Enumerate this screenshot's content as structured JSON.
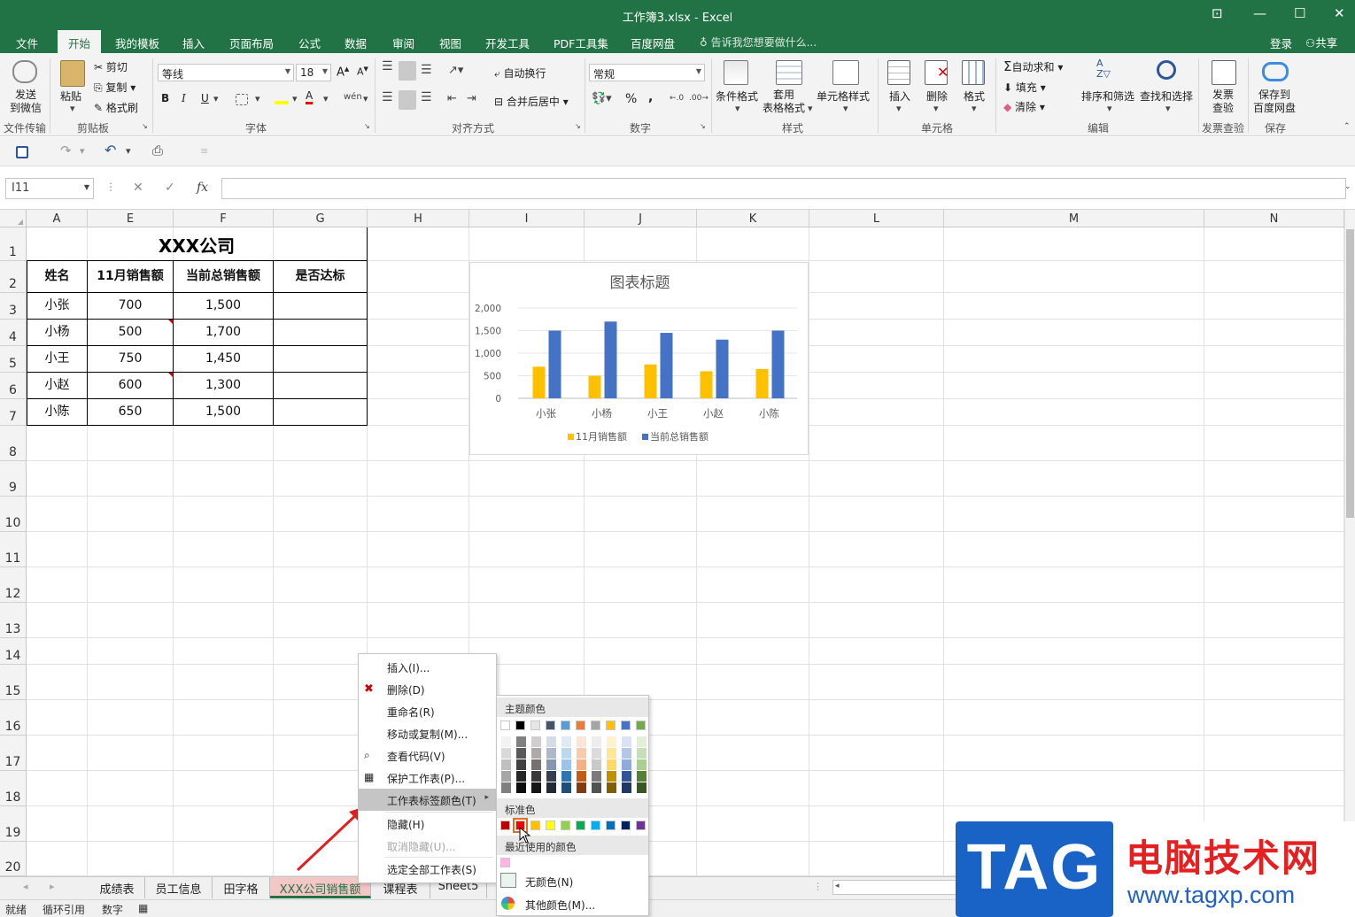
{
  "window": {
    "title": "工作簿3.xlsx - Excel",
    "controls": [
      "⊡",
      "—",
      "☐",
      "✕"
    ]
  },
  "menu": {
    "tabs": [
      "文件",
      "开始",
      "我的模板",
      "插入",
      "页面布局",
      "公式",
      "数据",
      "审阅",
      "视图",
      "开发工具",
      "PDF工具集",
      "百度网盘"
    ],
    "active": "开始",
    "tell_me": "告诉我您想要做什么...",
    "login": "登录",
    "share": "共享"
  },
  "ribbon": {
    "send_wechat": [
      "发送",
      "到微信"
    ],
    "group_file": "文件传输",
    "paste": "粘贴",
    "cut": "剪切",
    "copy": "复制",
    "format_painter": "格式刷",
    "group_clipboard": "剪贴板",
    "font_name": "等线",
    "font_size": "18",
    "bold": "B",
    "italic": "I",
    "underline": "U",
    "group_font": "字体",
    "wrap_text": "自动换行",
    "merge_center": "合并后居中",
    "group_align": "对齐方式",
    "number_format": "常规",
    "group_number": "数字",
    "percent": "%",
    "comma": ",",
    "cond_format": "条件格式",
    "table_format": [
      "套用",
      "表格格式"
    ],
    "cell_style": "单元格样式",
    "group_style": "样式",
    "insert": "插入",
    "delete": "删除",
    "format": "格式",
    "group_cells": "单元格",
    "autosum": "自动求和",
    "fill": "填充",
    "clear": "清除",
    "sort_filter": "排序和筛选",
    "find_select": "查找和选择",
    "group_edit": "编辑",
    "invoice_check": [
      "发票",
      "查验"
    ],
    "group_invoice": "发票查验",
    "save_baidu": [
      "保存到",
      "百度网盘"
    ],
    "group_save": "保存"
  },
  "formula_bar": {
    "name_box": "I11",
    "fx": "fx",
    "formula": ""
  },
  "columns": [
    {
      "label": "A"
    },
    {
      "label": "E"
    },
    {
      "label": "F"
    },
    {
      "label": "G"
    },
    {
      "label": "H"
    },
    {
      "label": "I"
    },
    {
      "label": "J"
    },
    {
      "label": "K"
    },
    {
      "label": "L"
    },
    {
      "label": "M"
    },
    {
      "label": "N"
    }
  ],
  "rows": [
    "1",
    "2",
    "3",
    "4",
    "5",
    "6",
    "7",
    "8",
    "9",
    "10",
    "11",
    "12",
    "13",
    "14",
    "15",
    "16",
    "17",
    "18",
    "19",
    "20"
  ],
  "table": {
    "title": "XXX公司",
    "headers": [
      "姓名",
      "11月销售额",
      "当前总销售额",
      "是否达标"
    ],
    "rows": [
      [
        "小张",
        "700",
        "1,500",
        ""
      ],
      [
        "小杨",
        "500",
        "1,700",
        ""
      ],
      [
        "小王",
        "750",
        "1,450",
        ""
      ],
      [
        "小赵",
        "600",
        "1,300",
        ""
      ],
      [
        "小陈",
        "650",
        "1,500",
        ""
      ]
    ]
  },
  "chart_data": {
    "type": "bar",
    "title": "图表标题",
    "categories": [
      "小张",
      "小杨",
      "小王",
      "小赵",
      "小陈"
    ],
    "series": [
      {
        "name": "11月销售额",
        "values": [
          700,
          500,
          750,
          600,
          650
        ],
        "color": "#ffc000"
      },
      {
        "name": "当前总销售额",
        "values": [
          1500,
          1700,
          1450,
          1300,
          1500
        ],
        "color": "#4472c4"
      }
    ],
    "ylim": [
      0,
      2000
    ],
    "yticks": [
      "0",
      "500",
      "1,000",
      "1,500",
      "2,000"
    ],
    "grid": true,
    "legend": "bottom"
  },
  "sheet_tabs": [
    "成绩表",
    "员工信息",
    "田字格",
    "XXX公司销售额",
    "课程表",
    "Sheet5"
  ],
  "active_sheet": "XXX公司销售额",
  "tab_active_color": "#f5c6c6",
  "status": {
    "ready": "就绪",
    "circular": "循环引用",
    "mode": "数字"
  },
  "context_menu": {
    "items": [
      {
        "label": "插入(I)...",
        "icon": "",
        "disabled": false
      },
      {
        "label": "删除(D)",
        "icon": "delete-sheet-icon",
        "disabled": false
      },
      {
        "label": "重命名(R)",
        "icon": "",
        "disabled": false
      },
      {
        "label": "移动或复制(M)...",
        "icon": "",
        "disabled": false
      },
      {
        "label": "查看代码(V)",
        "icon": "view-code-icon",
        "disabled": false
      },
      {
        "label": "保护工作表(P)...",
        "icon": "protect-sheet-icon",
        "disabled": false
      },
      {
        "label": "工作表标签颜色(T)",
        "icon": "",
        "disabled": false,
        "submenu": true,
        "highlighted": true
      },
      {
        "label": "隐藏(H)",
        "icon": "",
        "disabled": false
      },
      {
        "label": "取消隐藏(U)...",
        "icon": "",
        "disabled": true
      },
      {
        "label": "选定全部工作表(S)",
        "icon": "",
        "disabled": false
      }
    ]
  },
  "color_panel": {
    "theme_label": "主题颜色",
    "theme_colors": [
      "#ffffff",
      "#000000",
      "#e7e6e6",
      "#44546a",
      "#5b9bd5",
      "#ed7d31",
      "#a5a5a5",
      "#ffc000",
      "#4472c4",
      "#70ad47"
    ],
    "shade_columns": [
      [
        "#f2f2f2",
        "#d9d9d9",
        "#bfbfbf",
        "#a6a6a6",
        "#808080"
      ],
      [
        "#808080",
        "#595959",
        "#404040",
        "#262626",
        "#0d0d0d"
      ],
      [
        "#d0cece",
        "#aeaaaa",
        "#757171",
        "#3a3838",
        "#171616"
      ],
      [
        "#d6dce5",
        "#adb9ca",
        "#8497b0",
        "#333f50",
        "#222a35"
      ],
      [
        "#deebf7",
        "#bdd7ee",
        "#9dc3e6",
        "#2e75b6",
        "#1f4e79"
      ],
      [
        "#fbe5d6",
        "#f8cbad",
        "#f4b183",
        "#c55a11",
        "#843c0c"
      ],
      [
        "#ededed",
        "#dbdbdb",
        "#c9c9c9",
        "#7b7b7b",
        "#525252"
      ],
      [
        "#fff2cc",
        "#ffe699",
        "#ffd966",
        "#bf9000",
        "#7f6000"
      ],
      [
        "#dae3f3",
        "#b4c7e7",
        "#8faadc",
        "#2f5597",
        "#203864"
      ],
      [
        "#e2f0d9",
        "#c5e0b4",
        "#a9d18e",
        "#548235",
        "#385723"
      ]
    ],
    "standard_label": "标准色",
    "standard_colors": [
      "#c00000",
      "#ff0000",
      "#ffc000",
      "#ffff00",
      "#92d050",
      "#00b050",
      "#00b0f0",
      "#0070c0",
      "#002060",
      "#7030a0"
    ],
    "recent_label": "最近使用的颜色",
    "recent_colors": [
      "#ffb3e6"
    ],
    "no_color": "无颜色(N)",
    "more_colors": "其他颜色(M)..."
  },
  "watermark": {
    "logo": "TAG",
    "title": "电脑技术网",
    "url": "www.tagxp.com"
  }
}
